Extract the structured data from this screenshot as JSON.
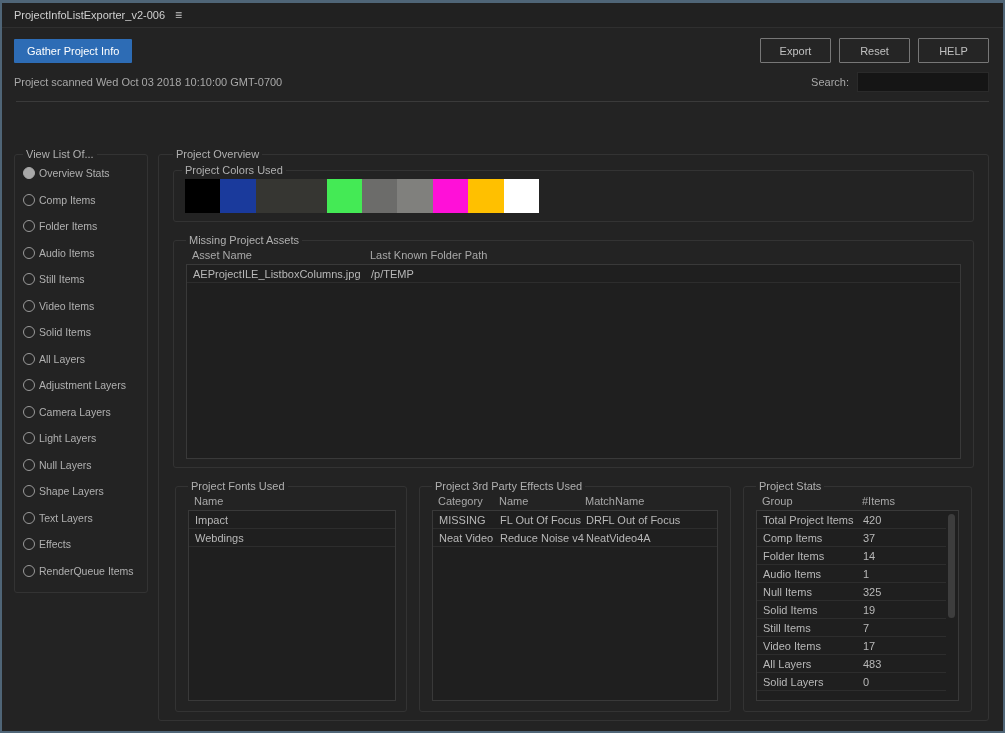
{
  "window": {
    "title": "ProjectInfoListExporter_v2-006",
    "menu": "≡"
  },
  "toolbar": {
    "gather_button": "Gather Project Info",
    "buttons": [
      "Export",
      "Reset",
      "HELP"
    ]
  },
  "scan_status": "Project scanned Wed Oct 03 2018 10:10:00 GMT-0700",
  "search": {
    "label": "Search:"
  },
  "view_list": {
    "title": "View List Of...",
    "items": [
      {
        "label": "Overview Stats",
        "selected": true
      },
      {
        "label": "Comp Items",
        "selected": false
      },
      {
        "label": "Folder Items",
        "selected": false
      },
      {
        "label": "Audio Items",
        "selected": false
      },
      {
        "label": "Still Items",
        "selected": false
      },
      {
        "label": "Video Items",
        "selected": false
      },
      {
        "label": "Solid Items",
        "selected": false
      },
      {
        "label": "All Layers",
        "selected": false
      },
      {
        "label": "Adjustment Layers",
        "selected": false
      },
      {
        "label": "Camera Layers",
        "selected": false
      },
      {
        "label": "Light Layers",
        "selected": false
      },
      {
        "label": "Null Layers",
        "selected": false
      },
      {
        "label": "Shape Layers",
        "selected": false
      },
      {
        "label": "Text Layers",
        "selected": false
      },
      {
        "label": "Effects",
        "selected": false
      },
      {
        "label": "RenderQueue Items",
        "selected": false
      }
    ]
  },
  "overview": {
    "title": "Project Overview",
    "colors": {
      "title": "Project Colors Used",
      "swatches": [
        {
          "color": "#000000"
        },
        {
          "color": "#1a3a9c"
        },
        {
          "color": "#363632"
        },
        {
          "color": "#363632"
        },
        {
          "color": "#44ea55"
        },
        {
          "color": "#6c6c6a"
        },
        {
          "color": "#80807d"
        },
        {
          "color": "#ff10d8"
        },
        {
          "color": "#ffc000"
        },
        {
          "color": "#ffffff"
        }
      ]
    },
    "missing_assets": {
      "title": "Missing Project Assets",
      "columns": [
        "Asset Name",
        "Last Known Folder Path"
      ],
      "rows": [
        [
          "AEProjectILE_ListboxColumns.jpg",
          "/p/TEMP"
        ]
      ]
    },
    "fonts": {
      "title": "Project Fonts Used",
      "columns": [
        "Name"
      ],
      "rows": [
        [
          "Impact"
        ],
        [
          "Webdings"
        ]
      ]
    },
    "effects": {
      "title": "Project 3rd Party Effects Used",
      "columns": [
        "Category",
        "Name",
        "MatchName"
      ],
      "rows": [
        [
          "MISSING",
          "FL Out Of Focus",
          "DRFL Out of Focus"
        ],
        [
          "Neat Video",
          "Reduce Noise v4",
          "NeatVideo4A"
        ]
      ]
    },
    "stats": {
      "title": "Project Stats",
      "columns": [
        "Group",
        "#Items"
      ],
      "rows": [
        [
          "Total Project Items",
          "420"
        ],
        [
          "Comp Items",
          "37"
        ],
        [
          "Folder Items",
          "14"
        ],
        [
          "Audio Items",
          "1"
        ],
        [
          "Null Items",
          "325"
        ],
        [
          "Solid Items",
          "19"
        ],
        [
          "Still Items",
          "7"
        ],
        [
          "Video Items",
          "17"
        ],
        [
          "All Layers",
          "483"
        ],
        [
          "Solid Layers",
          "0"
        ]
      ]
    }
  }
}
